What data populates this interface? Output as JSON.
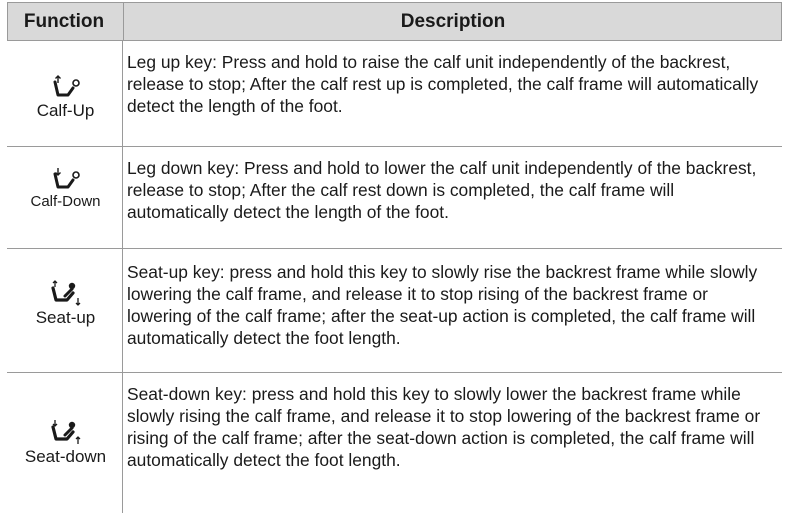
{
  "header": {
    "function": "Function",
    "description": "Description"
  },
  "rows": [
    {
      "icon": "calf-up-icon",
      "label": "Calf-Up",
      "description": "Leg up  key: Press and hold to raise the calf unit independently of the backrest, release to stop; After the calf rest up is completed, the calf frame will automatically detect the length of the foot."
    },
    {
      "icon": "calf-down-icon",
      "label": "Calf-Down",
      "description": "Leg down key: Press and hold to lower the calf unit independently of the backrest, release to stop; After the calf rest down is completed, the calf frame will automatically detect the length of the foot."
    },
    {
      "icon": "seat-up-icon",
      "label": "Seat-up",
      "description": "Seat-up key: press and hold this key to slowly rise the backrest frame while slowly lowering the calf frame, and release it to stop rising of the backrest frame or lowering of the calf frame; after the seat-up action is completed, the calf frame will automatically detect the foot length."
    },
    {
      "icon": "seat-down-icon",
      "label": "Seat-down",
      "description": "Seat-down key: press and hold this key to slowly lower the backrest frame while slowly rising the calf frame, and release it to stop lowering of the backrest frame or rising of the calf frame; after the seat-down action is completed, the calf frame will automatically detect the foot length."
    }
  ]
}
